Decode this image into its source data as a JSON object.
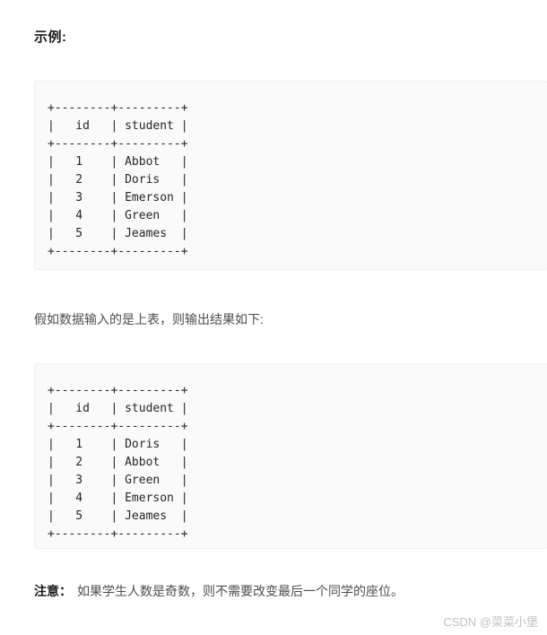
{
  "document": {
    "heading": "示例:",
    "middle_paragraph": "假如数据输入的是上表，则输出结果如下:",
    "note": {
      "label": "注意：",
      "text": "如果学生人数是奇数，则不需要改变最后一个同学的座位。"
    },
    "watermark": "CSDN @菜菜小堡"
  },
  "code_blocks": [
    {
      "name": "input-table",
      "text": "+--------+---------+\n|   id   | student |\n+--------+---------+\n|   1    | Abbot   |\n|   2    | Doris   |\n|   3    | Emerson |\n|   4    | Green   |\n|   5    | Jeames  |\n+--------+---------+",
      "table": {
        "columns": [
          "id",
          "student"
        ],
        "rows": [
          [
            "1",
            "Abbot"
          ],
          [
            "2",
            "Doris"
          ],
          [
            "3",
            "Emerson"
          ],
          [
            "4",
            "Green"
          ],
          [
            "5",
            "Jeames"
          ]
        ]
      }
    },
    {
      "name": "output-table",
      "text": "+--------+---------+\n|   id   | student |\n+--------+---------+\n|   1    | Doris   |\n|   2    | Abbot   |\n|   3    | Green   |\n|   4    | Emerson |\n|   5    | Jeames  |\n+--------+---------+",
      "table": {
        "columns": [
          "id",
          "student"
        ],
        "rows": [
          [
            "1",
            "Doris"
          ],
          [
            "2",
            "Abbot"
          ],
          [
            "3",
            "Green"
          ],
          [
            "4",
            "Emerson"
          ],
          [
            "5",
            "Jeames"
          ]
        ]
      }
    }
  ],
  "colors": {
    "page_background": "#ffffff",
    "code_background": "#fafafa",
    "code_border": "#f0f0f0",
    "code_text": "#262626",
    "body_text": "#4d4d4d",
    "heading_text": "#1a1a1a",
    "watermark_text": "#c2c2c2"
  }
}
